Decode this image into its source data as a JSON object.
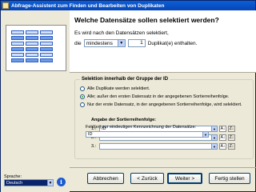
{
  "window": {
    "title": "Abfrage-Assistent zum Finden und Bearbeiten von Duplikaten"
  },
  "header": {
    "heading": "Welche Datensätze sollen selektiert werden?",
    "subtext": "Es wird nach den Datensätzen selektiert,",
    "prefix": "die",
    "mode_value": "mindestens",
    "count_value": "1",
    "suffix": "Duplikat(e) enthalten."
  },
  "selection": {
    "title": "Selektion innerhalb der Gruppe der ID",
    "options": [
      {
        "label": "Alle Duplikate werden selektiert.",
        "checked": false
      },
      {
        "label": "Alle; außer den ersten Datensatz in der angegebenen Sortierreihenfolge.",
        "checked": true
      },
      {
        "label": "Nur der erste Datensatz, in der angegebenen Sortierreihenfolge, wird selektiert.",
        "checked": false
      }
    ],
    "sort_label": "Angabe der Sortierreihenfolge:",
    "sort_rows": [
      {
        "num": "1.:",
        "value": "ID"
      },
      {
        "num": "2.:",
        "value": ""
      },
      {
        "num": "3.:",
        "value": ""
      }
    ],
    "sort_asc_icon": "sort-ascending-icon",
    "sort_desc_icon": "sort-descending-icon",
    "field_label": "Feld(er) zur eindeutigen Kennzeichnung der Datensätze:",
    "field_value": "ID"
  },
  "language": {
    "label": "Sprache:",
    "value": "Deutsch"
  },
  "buttons": {
    "cancel": "Abbrechen",
    "back": "< Zurück",
    "next": "Weiter >",
    "finish": "Fertig stellen"
  }
}
